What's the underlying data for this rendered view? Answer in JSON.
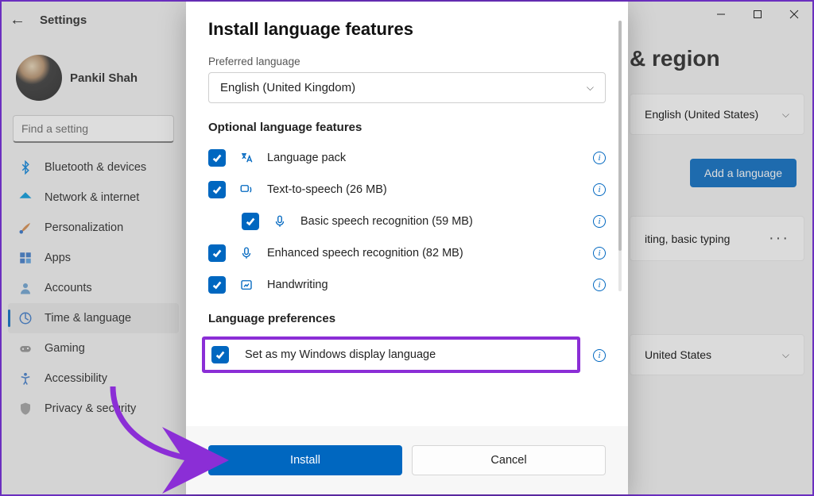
{
  "window": {
    "app_title": "Settings",
    "user_name": "Pankil Shah",
    "search_placeholder": "Find a setting"
  },
  "nav": {
    "items": [
      {
        "label": "Bluetooth & devices"
      },
      {
        "label": "Network & internet"
      },
      {
        "label": "Personalization"
      },
      {
        "label": "Apps"
      },
      {
        "label": "Accounts"
      },
      {
        "label": "Time & language"
      },
      {
        "label": "Gaming"
      },
      {
        "label": "Accessibility"
      },
      {
        "label": "Privacy & security"
      }
    ]
  },
  "page": {
    "title_fragment": "& region",
    "display_lang": "English (United States)",
    "add_language_label": "Add a language",
    "pref_hint": "iting, basic typing",
    "country": "United States"
  },
  "modal": {
    "title": "Install language features",
    "preferred_label": "Preferred language",
    "preferred_value": "English (United Kingdom)",
    "section_optional": "Optional language features",
    "section_prefs": "Language preferences",
    "features": {
      "lang_pack": "Language pack",
      "tts": "Text-to-speech (26 MB)",
      "basic_speech": "Basic speech recognition (59 MB)",
      "enhanced_speech": "Enhanced speech recognition (82 MB)",
      "handwriting": "Handwriting",
      "set_display": "Set as my Windows display language"
    },
    "install_label": "Install",
    "cancel_label": "Cancel"
  }
}
